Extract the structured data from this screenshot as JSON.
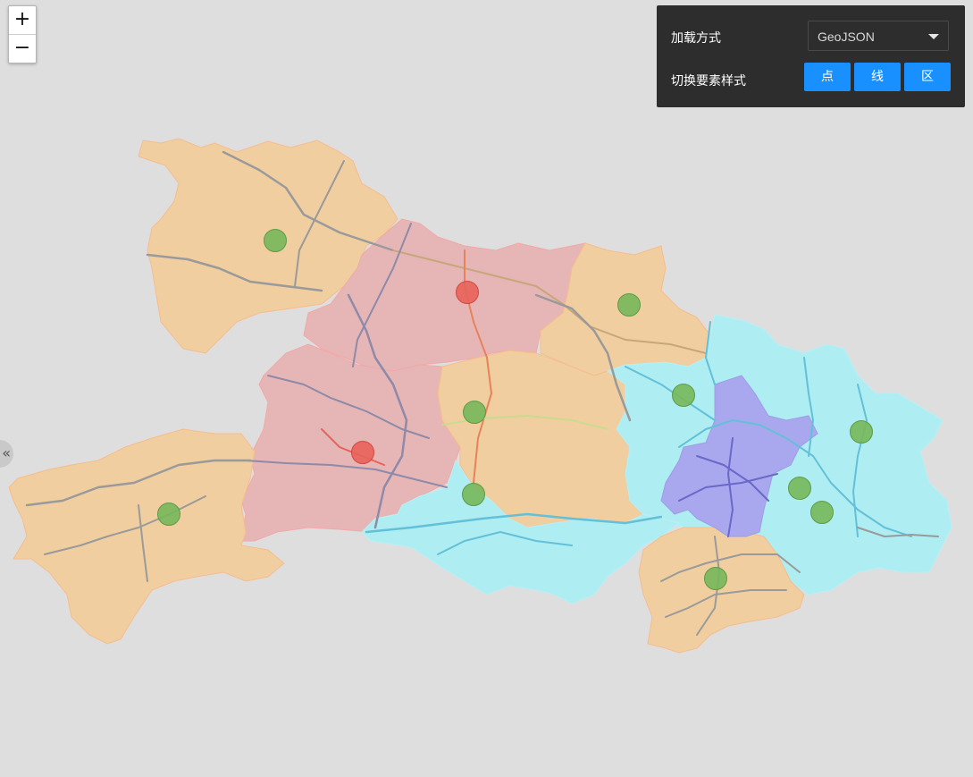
{
  "zoom": {
    "in_label": "+",
    "out_label": "−"
  },
  "side_toggle": {
    "label": "«"
  },
  "panel": {
    "load_label": "加载方式",
    "load_value": "GeoJSON",
    "style_label": "切换要素样式",
    "buttons": [
      "点",
      "线",
      "区"
    ]
  },
  "colors": {
    "background": "#dedede",
    "orange": "#f0cea0",
    "red": "#e6b6b6",
    "cyan": "#aeeef2",
    "purple": "#a9a8ee",
    "marker_green": "#77b75a",
    "marker_red": "#e8625a",
    "button_blue": "#1890ff"
  },
  "map": {
    "markers": [
      {
        "color": "green"
      },
      {
        "color": "red"
      },
      {
        "color": "green"
      },
      {
        "color": "green"
      },
      {
        "color": "green"
      },
      {
        "color": "red"
      },
      {
        "color": "green"
      },
      {
        "color": "green"
      },
      {
        "color": "green"
      },
      {
        "color": "green"
      },
      {
        "color": "green"
      },
      {
        "color": "green"
      }
    ]
  }
}
